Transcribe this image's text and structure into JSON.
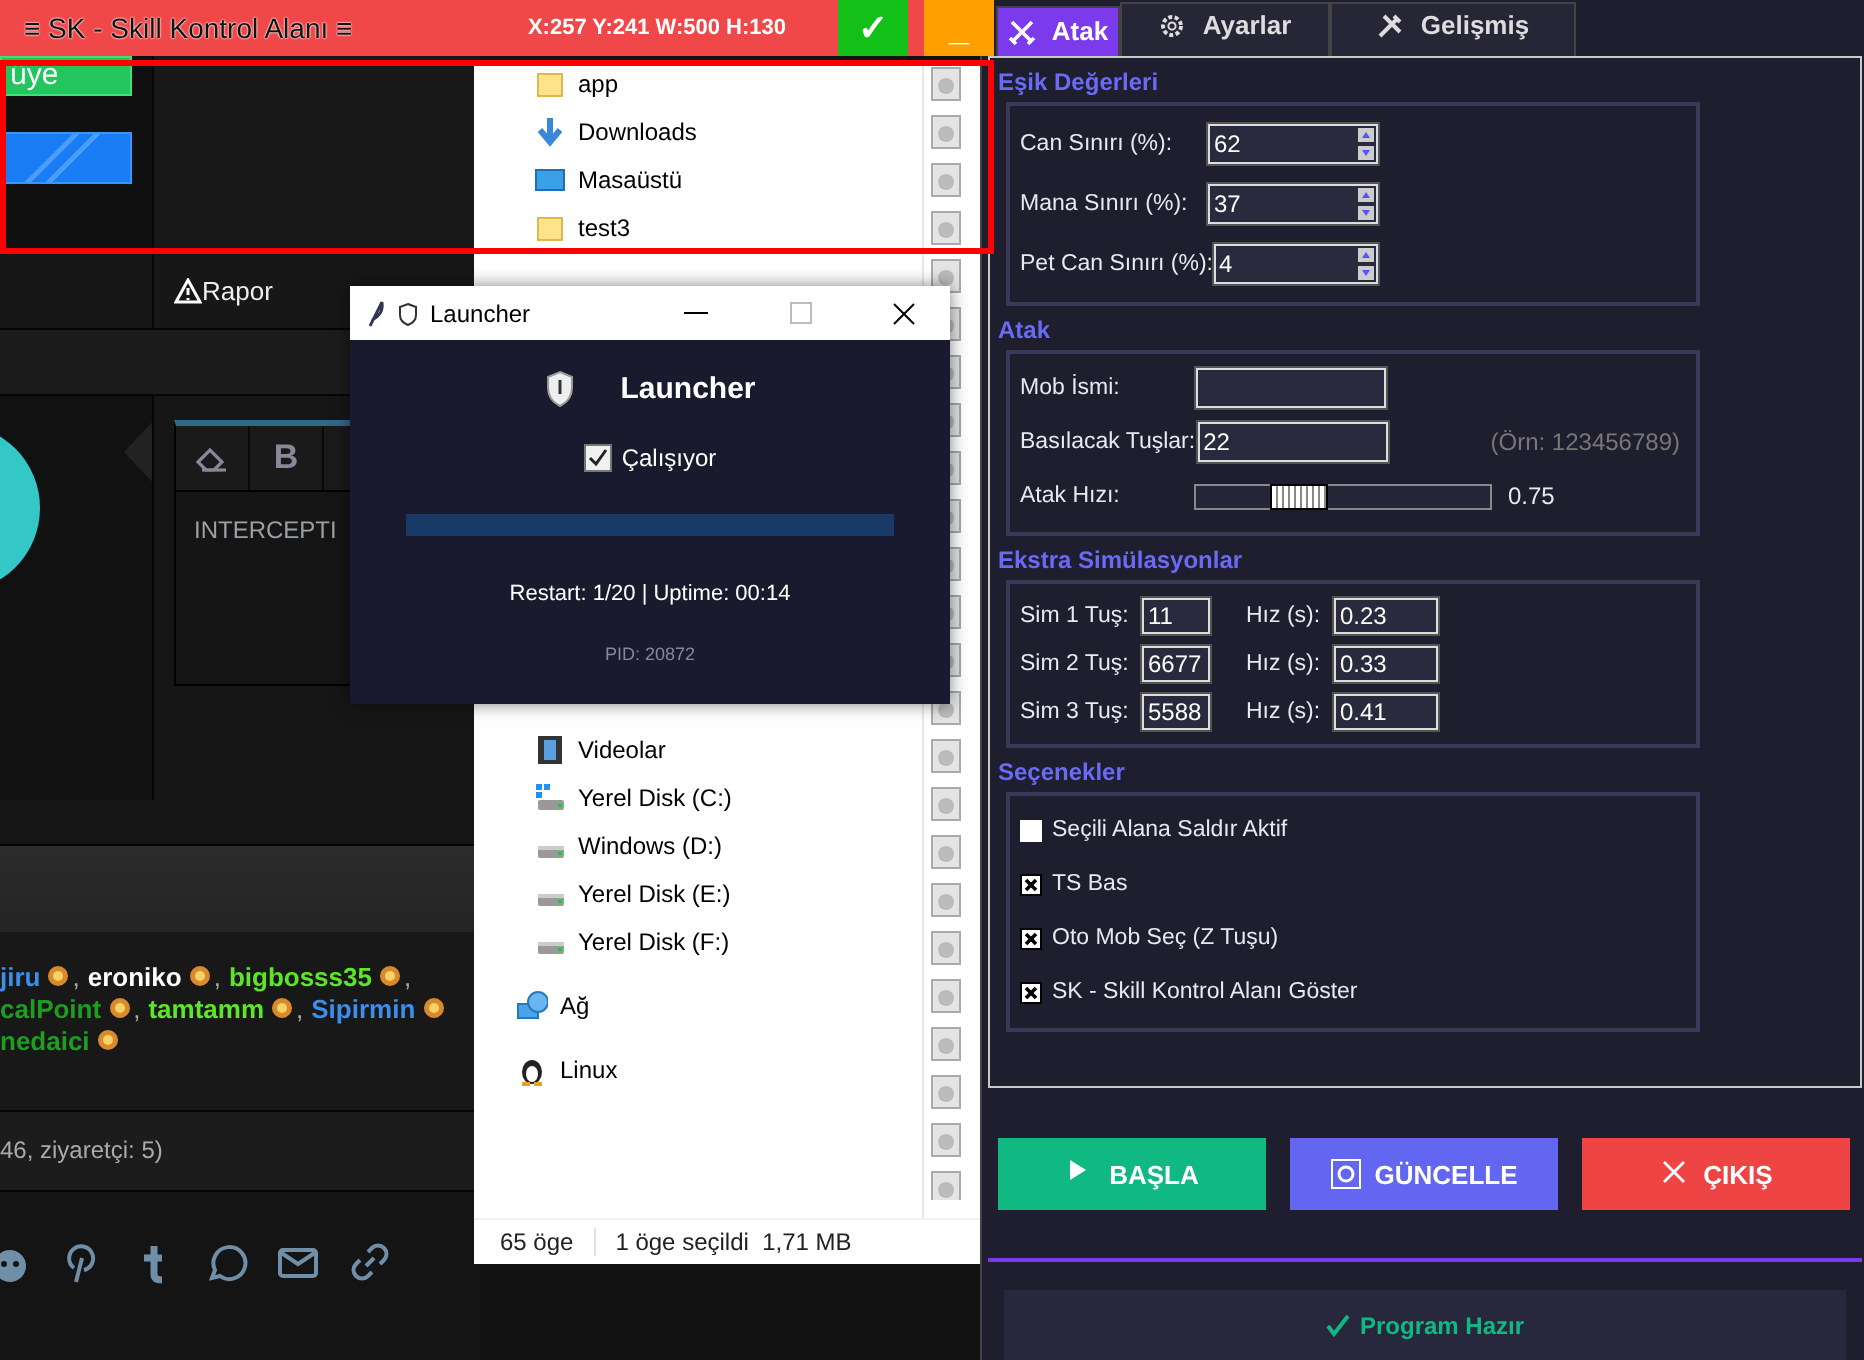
{
  "forum_page": {
    "join_button": "üye",
    "report_link": "Rapor",
    "editor_bold_label": "B",
    "editor_text": "INTERCEPTI",
    "online_users": {
      "lines": [
        {
          "users": [
            {
              "name": "jiru",
              "color": "#3b8eea",
              "suffix": ","
            },
            {
              "name": "eroniko",
              "color": "#ffffff",
              "suffix": ","
            },
            {
              "name": "bigbosss35",
              "color": "#5de52a",
              "suffix": ","
            }
          ]
        },
        {
          "users": [
            {
              "name": "calPoint",
              "color": "#1e9e1e",
              "suffix": ","
            },
            {
              "name": "tamtamm",
              "color": "#5de52a",
              "suffix": ","
            },
            {
              "name": "Sipirmin",
              "color": "#3b8eea"
            }
          ]
        },
        {
          "users": [
            {
              "name": "nedaici",
              "color": "#1e9e1e"
            }
          ]
        }
      ]
    },
    "online_summary": "46, ziyaretçi: 5)"
  },
  "file_explorer": {
    "items": [
      {
        "name": "app",
        "kind": "folder"
      },
      {
        "name": "Downloads",
        "kind": "download"
      },
      {
        "name": "Masaüstü",
        "kind": "desktop"
      },
      {
        "name": "test3",
        "kind": "folder"
      },
      {
        "name": "Videolar",
        "kind": "video"
      },
      {
        "name": "Yerel Disk (C:)",
        "kind": "system-drive"
      },
      {
        "name": "Windows (D:)",
        "kind": "drive"
      },
      {
        "name": "Yerel Disk (E:)",
        "kind": "drive"
      },
      {
        "name": "Yerel Disk (F:)",
        "kind": "drive"
      },
      {
        "name": "Ağ",
        "kind": "network"
      },
      {
        "name": "Linux",
        "kind": "linux"
      }
    ],
    "status_bar": {
      "item_count": "65 öge",
      "selection": "1 öge seçildi",
      "size": "1,71 MB"
    }
  },
  "sk_overlay": {
    "title": "≡ SK - Skill Kontrol Alanı ≡",
    "coordinates": "X:257 Y:241 W:500 H:130",
    "buttons": [
      {
        "label": "✓",
        "kind": "confirm"
      },
      {
        "label": "_",
        "kind": "minimize"
      }
    ]
  },
  "launcher": {
    "title": "Launcher",
    "heading": "Launcher",
    "running": {
      "label": "Çalışıyor",
      "checked": true
    },
    "progress": {
      "level": 1
    },
    "stats": "Restart: 1/20 | Uptime: 00:14",
    "pid": "PID: 20872"
  },
  "bot_panel": {
    "tabs": [
      {
        "label": "Atak",
        "selected": true
      },
      {
        "label": "Ayarlar",
        "selected": false
      },
      {
        "label": "Gelişmiş",
        "selected": false
      }
    ],
    "sections": [
      {
        "title": "Eşik Değerleri",
        "rows": [
          {
            "kind": "spinbox",
            "label": "Can Sınırı (%):",
            "value": "62"
          },
          {
            "kind": "spinbox",
            "label": "Mana Sınırı (%):",
            "value": "37"
          },
          {
            "kind": "spinbox",
            "label": "Pet Can Sınırı (%):",
            "value": "4"
          }
        ]
      },
      {
        "title": "Atak",
        "rows": [
          {
            "kind": "text",
            "label": "Mob İsmi:"
          },
          {
            "kind": "text",
            "label": "Basılacak Tuşlar:",
            "value": "22",
            "hint": "(Örn: 123456789)"
          },
          {
            "kind": "slider",
            "label": "Atak Hızı:",
            "level": 0.31,
            "reading": "0.75"
          }
        ]
      },
      {
        "title": "Ekstra Simülasyonlar",
        "rows": [
          {
            "kind": "pair",
            "label": "Sim 1 Tuş:",
            "value": "11",
            "speed_label": "Hız (s):",
            "speed": "0.23"
          },
          {
            "kind": "pair",
            "label": "Sim 2 Tuş:",
            "value": "6677",
            "speed_label": "Hız (s):",
            "speed": "0.33"
          },
          {
            "kind": "pair",
            "label": "Sim 3 Tuş:",
            "value": "5588",
            "speed_label": "Hız (s):",
            "speed": "0.41"
          }
        ]
      },
      {
        "title": "Seçenekler",
        "rows": [
          {
            "kind": "checkbox",
            "label": "Seçili Alana Saldır Aktif",
            "checked": false
          },
          {
            "kind": "checkbox",
            "label": "TS Bas",
            "checked": true
          },
          {
            "kind": "checkbox",
            "label": "Oto Mob Seç (Z Tuşu)",
            "checked": true
          },
          {
            "kind": "checkbox",
            "label": "SK - Skill Kontrol Alanı Göster",
            "checked": true
          }
        ]
      }
    ],
    "buttons": [
      {
        "label": "BAŞLA",
        "kind": "start"
      },
      {
        "label": "GÜNCELLE",
        "kind": "update"
      },
      {
        "label": "ÇIKIŞ",
        "kind": "exit"
      }
    ],
    "status": "Program Hazır"
  }
}
